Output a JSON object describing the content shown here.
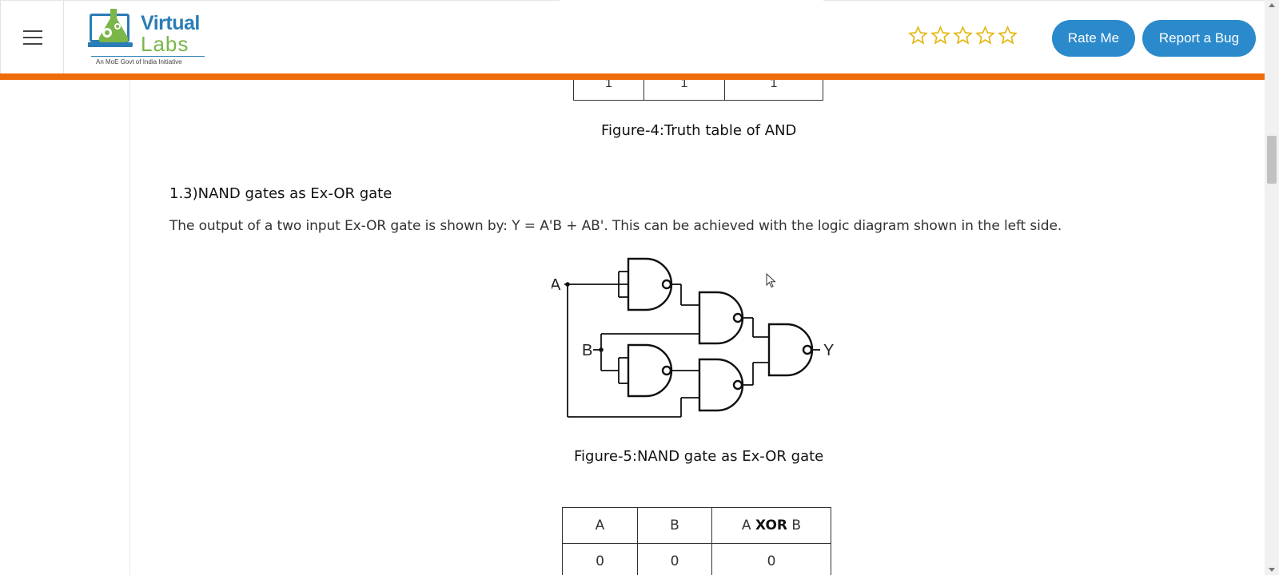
{
  "header": {
    "logo": {
      "title_1": "Virtual",
      "title_2": "Labs",
      "tagline": "An MoE Govt of India Initiative"
    },
    "rating": {
      "stars_total": 5,
      "stars_filled": 0,
      "star_color": "#e3b712"
    },
    "rate_button": "Rate Me",
    "bug_button": "Report a Bug",
    "accent_color": "#ef6c0a",
    "button_color": "#2b8acb"
  },
  "content": {
    "truth_and_table": {
      "last_row": [
        "1",
        "1",
        "1"
      ]
    },
    "figure4_caption": "Figure-4:Truth table of AND",
    "section_heading": "1.3)NAND gates as Ex-OR gate",
    "paragraph": "The output of a two input Ex-OR gate is shown by: Y = A'B + AB'. This can be achieved with the logic diagram shown in the left side.",
    "diagram": {
      "label_a": "A",
      "label_b": "B",
      "label_y": "Y"
    },
    "figure5_caption": "Figure-5:NAND gate as Ex-OR gate",
    "xor_table": {
      "headers": [
        "A",
        "B",
        "A",
        "XOR",
        "B"
      ],
      "rows": [
        [
          "0",
          "0",
          "0"
        ]
      ]
    }
  }
}
